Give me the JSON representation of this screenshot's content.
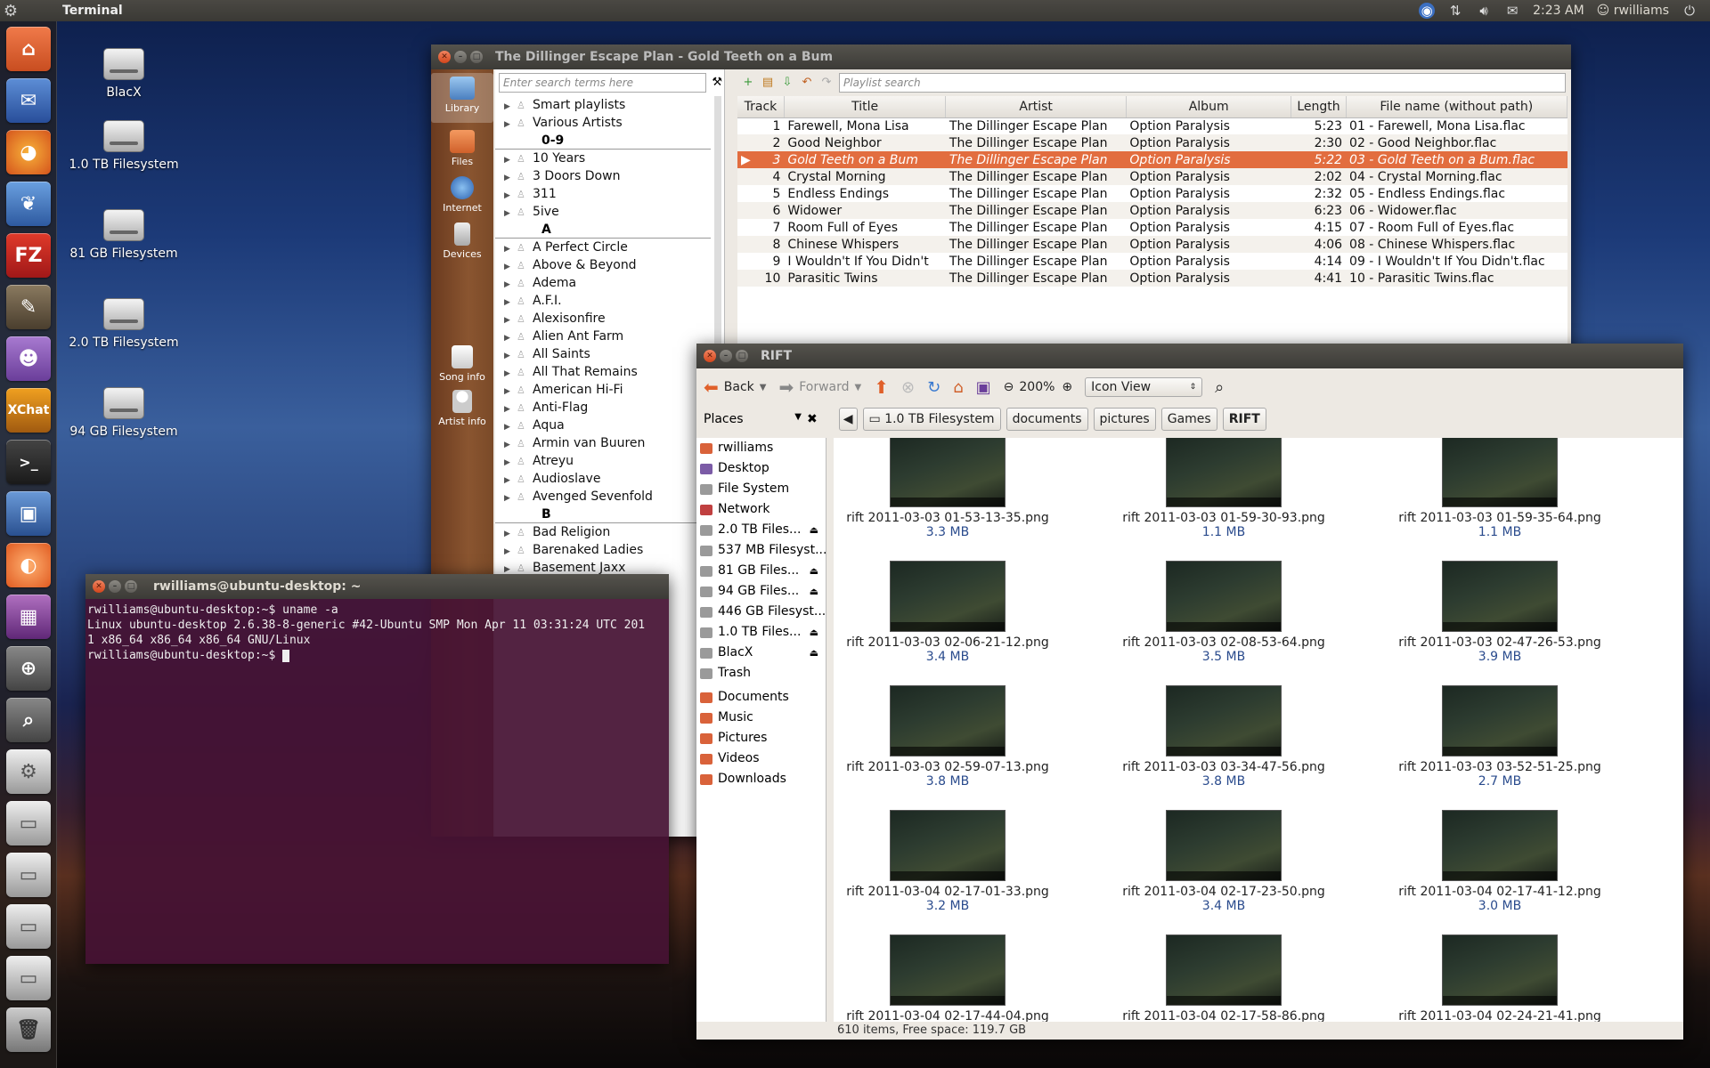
{
  "topbar": {
    "app_title": "Terminal",
    "time": "2:23 AM",
    "user": "rwilliams"
  },
  "desktop": {
    "icons": [
      "BlacX",
      "1.0 TB Filesystem",
      "81 GB Filesystem",
      "2.0 TB Filesystem",
      "94 GB Filesystem"
    ]
  },
  "launcher": {
    "items": [
      "home-folder",
      "thunderbird",
      "firefox",
      "pidgin-bird",
      "filezilla",
      "gimp",
      "empathy",
      "xchat",
      "terminal",
      "virtualbox",
      "clementine",
      "workspace-switcher",
      "magnifier",
      "search",
      "blacx-drive",
      "drive-1",
      "drive-2",
      "drive-3",
      "drive-4",
      "trash"
    ]
  },
  "clementine": {
    "title": "The Dillinger Escape Plan - Gold Teeth on a Bum",
    "tabs": [
      "Library",
      "Files",
      "Internet",
      "Devices",
      "Song info",
      "Artist info"
    ],
    "library_search_placeholder": "Enter search terms here",
    "playlist_search_placeholder": "Playlist search",
    "library_rows": [
      {
        "type": "item",
        "label": "Smart playlists"
      },
      {
        "type": "item",
        "label": "Various Artists"
      },
      {
        "type": "header",
        "label": "0-9"
      },
      {
        "type": "item",
        "label": "10 Years"
      },
      {
        "type": "item",
        "label": "3 Doors Down"
      },
      {
        "type": "item",
        "label": "311"
      },
      {
        "type": "item",
        "label": "5ive"
      },
      {
        "type": "header",
        "label": "A"
      },
      {
        "type": "item",
        "label": "A Perfect Circle"
      },
      {
        "type": "item",
        "label": "Above & Beyond"
      },
      {
        "type": "item",
        "label": "Adema"
      },
      {
        "type": "item",
        "label": "A.F.I."
      },
      {
        "type": "item",
        "label": "Alexisonfire"
      },
      {
        "type": "item",
        "label": "Alien Ant Farm"
      },
      {
        "type": "item",
        "label": "All Saints"
      },
      {
        "type": "item",
        "label": "All That Remains"
      },
      {
        "type": "item",
        "label": "American Hi-Fi"
      },
      {
        "type": "item",
        "label": "Anti-Flag"
      },
      {
        "type": "item",
        "label": "Aqua"
      },
      {
        "type": "item",
        "label": "Armin van Buuren"
      },
      {
        "type": "item",
        "label": "Atreyu"
      },
      {
        "type": "item",
        "label": "Audioslave"
      },
      {
        "type": "item",
        "label": "Avenged Sevenfold"
      },
      {
        "type": "header",
        "label": "B"
      },
      {
        "type": "item",
        "label": "Bad Religion"
      },
      {
        "type": "item",
        "label": "Barenaked Ladies"
      },
      {
        "type": "item",
        "label": "Basement Jaxx"
      }
    ],
    "columns": [
      "Track",
      "Title",
      "Artist",
      "Album",
      "Length",
      "File name (without path)"
    ],
    "tracks": [
      {
        "n": "1",
        "title": "Farewell, Mona Lisa",
        "artist": "The Dillinger Escape Plan",
        "album": "Option Paralysis",
        "length": "5:23",
        "file": "01 - Farewell, Mona Lisa.flac"
      },
      {
        "n": "2",
        "title": "Good Neighbor",
        "artist": "The Dillinger Escape Plan",
        "album": "Option Paralysis",
        "length": "2:30",
        "file": "02 - Good Neighbor.flac"
      },
      {
        "n": "3",
        "title": "Gold Teeth on a Bum",
        "artist": "The Dillinger Escape Plan",
        "album": "Option Paralysis",
        "length": "5:22",
        "file": "03 - Gold Teeth on a Bum.flac"
      },
      {
        "n": "4",
        "title": "Crystal Morning",
        "artist": "The Dillinger Escape Plan",
        "album": "Option Paralysis",
        "length": "2:02",
        "file": "04 - Crystal Morning.flac"
      },
      {
        "n": "5",
        "title": "Endless Endings",
        "artist": "The Dillinger Escape Plan",
        "album": "Option Paralysis",
        "length": "2:32",
        "file": "05 - Endless Endings.flac"
      },
      {
        "n": "6",
        "title": "Widower",
        "artist": "The Dillinger Escape Plan",
        "album": "Option Paralysis",
        "length": "6:23",
        "file": "06 - Widower.flac"
      },
      {
        "n": "7",
        "title": "Room Full of Eyes",
        "artist": "The Dillinger Escape Plan",
        "album": "Option Paralysis",
        "length": "4:15",
        "file": "07 - Room Full of Eyes.flac"
      },
      {
        "n": "8",
        "title": "Chinese Whispers",
        "artist": "The Dillinger Escape Plan",
        "album": "Option Paralysis",
        "length": "4:06",
        "file": "08 - Chinese Whispers.flac"
      },
      {
        "n": "9",
        "title": "I Wouldn't If You Didn't",
        "artist": "The Dillinger Escape Plan",
        "album": "Option Paralysis",
        "length": "4:14",
        "file": "09 - I Wouldn't If You Didn't.flac"
      },
      {
        "n": "10",
        "title": "Parasitic Twins",
        "artist": "The Dillinger Escape Plan",
        "album": "Option Paralysis",
        "length": "4:41",
        "file": "10 - Parasitic Twins.flac"
      }
    ],
    "selected_track": 3
  },
  "terminal": {
    "title": "rwilliams@ubuntu-desktop: ~",
    "lines": [
      "rwilliams@ubuntu-desktop:~$ uname -a",
      "Linux ubuntu-desktop 2.6.38-8-generic #42-Ubuntu SMP Mon Apr 11 03:31:24 UTC 201",
      "1 x86_64 x86_64 x86_64 GNU/Linux"
    ],
    "prompt": "rwilliams@ubuntu-desktop:~$ "
  },
  "nautilus": {
    "title": "RIFT",
    "toolbar": {
      "back": "Back",
      "forward": "Forward",
      "zoom": "200%",
      "view": "Icon View"
    },
    "places_label": "Places",
    "breadcrumbs": [
      "1.0 TB Filesystem",
      "documents",
      "pictures",
      "Games",
      "RIFT"
    ],
    "places": [
      {
        "label": "rwilliams",
        "color": "#d9623a",
        "eject": false
      },
      {
        "label": "Desktop",
        "color": "#7b5ba6",
        "eject": false
      },
      {
        "label": "File System",
        "color": "#9a9a9a",
        "eject": false
      },
      {
        "label": "Network",
        "color": "#c04040",
        "eject": false
      },
      {
        "label": "2.0 TB Files...",
        "color": "#9a9a9a",
        "eject": true
      },
      {
        "label": "537 MB Filesyst...",
        "color": "#9a9a9a",
        "eject": false
      },
      {
        "label": "81 GB Files...",
        "color": "#9a9a9a",
        "eject": true
      },
      {
        "label": "94 GB Files...",
        "color": "#9a9a9a",
        "eject": true
      },
      {
        "label": "446 GB Filesyst...",
        "color": "#9a9a9a",
        "eject": false
      },
      {
        "label": "1.0 TB Files...",
        "color": "#9a9a9a",
        "eject": true
      },
      {
        "label": "BlacX",
        "color": "#9a9a9a",
        "eject": true
      },
      {
        "label": "Trash",
        "color": "#9a9a9a",
        "eject": false
      },
      {
        "label": "Documents",
        "color": "#d9623a",
        "eject": false
      },
      {
        "label": "Music",
        "color": "#d9623a",
        "eject": false
      },
      {
        "label": "Pictures",
        "color": "#d9623a",
        "eject": false
      },
      {
        "label": "Videos",
        "color": "#d9623a",
        "eject": false
      },
      {
        "label": "Downloads",
        "color": "#d9623a",
        "eject": false
      }
    ],
    "files": [
      {
        "name": "rift 2011-03-03 01-53-13-35.png",
        "size": "3.3 MB"
      },
      {
        "name": "rift 2011-03-03 01-59-30-93.png",
        "size": "1.1 MB"
      },
      {
        "name": "rift 2011-03-03 01-59-35-64.png",
        "size": "1.1 MB"
      },
      {
        "name": "rift 2011-03-03 02-06-21-12.png",
        "size": "3.4 MB"
      },
      {
        "name": "rift 2011-03-03 02-08-53-64.png",
        "size": "3.5 MB"
      },
      {
        "name": "rift 2011-03-03 02-47-26-53.png",
        "size": "3.9 MB"
      },
      {
        "name": "rift 2011-03-03 02-59-07-13.png",
        "size": "3.8 MB"
      },
      {
        "name": "rift 2011-03-03 03-34-47-56.png",
        "size": "3.8 MB"
      },
      {
        "name": "rift 2011-03-03 03-52-51-25.png",
        "size": "2.7 MB"
      },
      {
        "name": "rift 2011-03-04 02-17-01-33.png",
        "size": "3.2 MB"
      },
      {
        "name": "rift 2011-03-04 02-17-23-50.png",
        "size": "3.4 MB"
      },
      {
        "name": "rift 2011-03-04 02-17-41-12.png",
        "size": "3.0 MB"
      },
      {
        "name": "rift 2011-03-04 02-17-44-04.png",
        "size": ""
      },
      {
        "name": "rift 2011-03-04 02-17-58-86.png",
        "size": ""
      },
      {
        "name": "rift 2011-03-04 02-24-21-41.png",
        "size": ""
      }
    ],
    "status": "610 items, Free space: 119.7 GB"
  }
}
